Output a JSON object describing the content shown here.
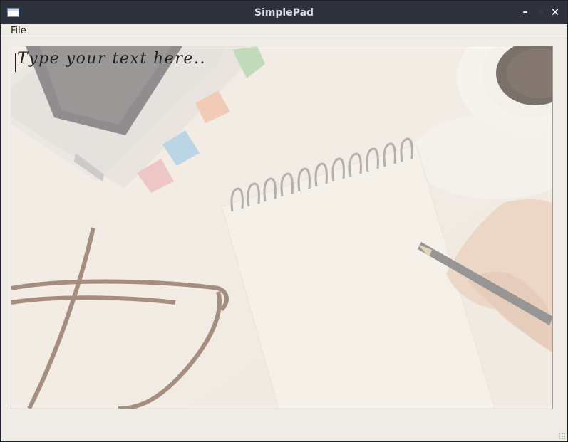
{
  "window": {
    "title": "SimplePad",
    "controls": {
      "minimize": "–",
      "maximize": "◦",
      "close": "✕"
    }
  },
  "menu": {
    "file_label": "File"
  },
  "editor": {
    "placeholder": "Type your text here.."
  },
  "icons": {
    "app": "app-window-icon",
    "minimize": "minimize-icon",
    "maximize": "maximize-icon",
    "close": "close-icon"
  },
  "colors": {
    "titlebar": "#2e323d",
    "window_bg": "#efece6",
    "editor_bg": "#f1ece4"
  }
}
